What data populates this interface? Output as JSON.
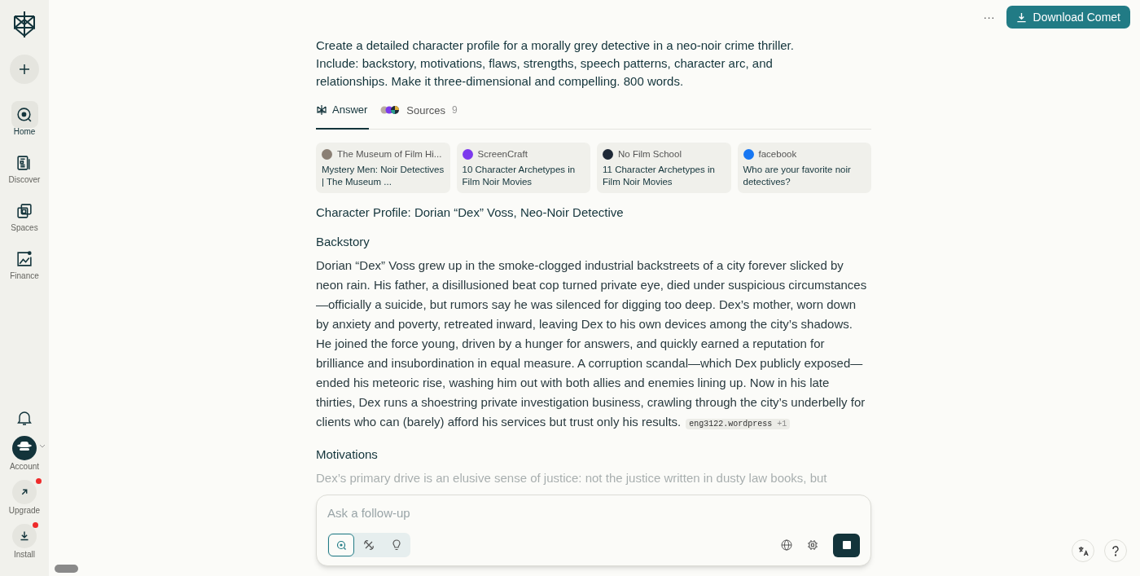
{
  "sidebar": {
    "nav": [
      {
        "label": "Home",
        "kind": "home",
        "selected": true
      },
      {
        "label": "Discover",
        "kind": "discover",
        "selected": false
      },
      {
        "label": "Spaces",
        "kind": "spaces",
        "selected": false
      },
      {
        "label": "Finance",
        "kind": "finance",
        "selected": false
      }
    ],
    "bottom": [
      {
        "label": "Account",
        "kind": "account",
        "notification": false
      },
      {
        "label": "Upgrade",
        "kind": "upgrade",
        "notification": true
      },
      {
        "label": "Install",
        "kind": "install",
        "notification": true
      }
    ]
  },
  "top_bar": {
    "more": "···",
    "download_button": "Download Comet"
  },
  "query": "Create a detailed character profile for a morally grey detective in a neo-noir crime thriller. Include: backstory, motivations, flaws, strengths, speech patterns, character arc, and relationships. Make it three-dimensional and compelling. 800 words.",
  "tabs": [
    {
      "label": "Answer",
      "kind": "answer",
      "selected": true
    },
    {
      "label": "Sources",
      "kind": "sources",
      "count": "9",
      "selected": false
    }
  ],
  "sources": [
    {
      "site": "The Museum of Film Hi...",
      "title": "Mystery Men: Noir Detectives | The Museum ...",
      "color": "#8a7f74"
    },
    {
      "site": "ScreenCraft",
      "title": "10 Character Archetypes in Film Noir Movies",
      "color": "#7c3aed"
    },
    {
      "site": "No Film School",
      "title": "11 Character Archetypes in Film Noir Movies",
      "color": "#1f2937"
    },
    {
      "site": "facebook",
      "title": "Who are your favorite noir detectives?",
      "color": "#1877f2"
    }
  ],
  "answer": {
    "title": "Character Profile: Dorian “Dex” Voss, Neo-Noir Detective",
    "sections": [
      {
        "heading": "Backstory",
        "text": "Dorian “Dex” Voss grew up in the smoke-clogged industrial backstreets of a city forever slicked by neon rain. His father, a disillusioned beat cop turned private eye, died under suspicious circumstances—officially a suicide, but rumors say he was silenced for digging too deep. Dex’s mother, worn down by anxiety and poverty, retreated inward, leaving Dex to his own devices among the city’s shadows. He joined the force young, driven by a hunger for answers, and quickly earned a reputation for brilliance and insubordination in equal measure. A corruption scandal—which Dex publicly exposed—ended his meteoric rise, washing him out with both allies and enemies lining up. Now in his late thirties, Dex runs a shoestring private investigation business, crawling through the city’s underbelly for clients who can (barely) afford his services but trust only his results.",
        "citation": "eng3122.wordpress",
        "citation_more": "+1"
      },
      {
        "heading": "Motivations",
        "text": "Dex’s primary drive is an elusive sense of justice: not the justice written in dusty law books, but"
      }
    ]
  },
  "composer": {
    "placeholder": "Ask a follow-up",
    "modes": [
      {
        "kind": "search",
        "selected": true
      },
      {
        "kind": "reasoning",
        "selected": false
      },
      {
        "kind": "bulb",
        "selected": false
      }
    ]
  }
}
